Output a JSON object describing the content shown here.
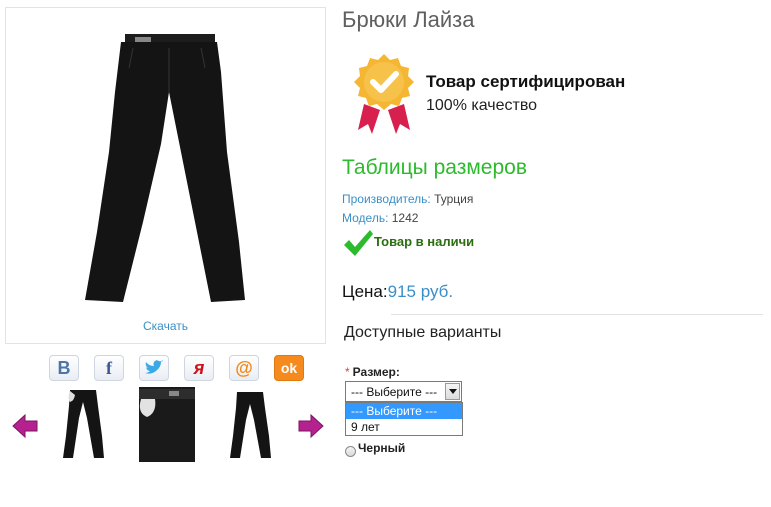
{
  "product": {
    "title": "Брюки Лайза",
    "download_label": "Скачать"
  },
  "certificate": {
    "title": "Товар сертифицирован",
    "subtitle": "100% качество"
  },
  "size_table_label": "Таблицы размеров",
  "meta": {
    "manufacturer_label": "Производитель:",
    "manufacturer_value": "Турция",
    "model_label": "Модель:",
    "model_value": "1242"
  },
  "stock_label": "Товар в наличи",
  "price": {
    "label": "Цена:",
    "value": "915 руб."
  },
  "variants": {
    "heading": "Доступные варианты",
    "size_label": "Размер:",
    "required_mark": "*",
    "select_value": "--- Выберите ---",
    "options": [
      "--- Выберите ---",
      "9 лет"
    ],
    "color_label": "Черный"
  },
  "share": {
    "buttons": [
      {
        "name": "vk",
        "glyph": "B",
        "color": "#4a76a8"
      },
      {
        "name": "facebook",
        "glyph": "f",
        "color": "#3b5998"
      },
      {
        "name": "twitter",
        "glyph": "",
        "color": "#3aa9e8"
      },
      {
        "name": "yaru",
        "glyph": "я",
        "color": "#d0101b"
      },
      {
        "name": "mailru",
        "glyph": "@",
        "color": "#f08a1a"
      },
      {
        "name": "odnoklassniki",
        "glyph": "ok",
        "color": "#ffffff"
      }
    ]
  },
  "colors": {
    "accent_blue": "#3a8fc7",
    "green": "#2cbb2c",
    "arrow_purple": "#b5228f",
    "badge_gold": "#f4b633",
    "ribbon": "#d8204f"
  }
}
